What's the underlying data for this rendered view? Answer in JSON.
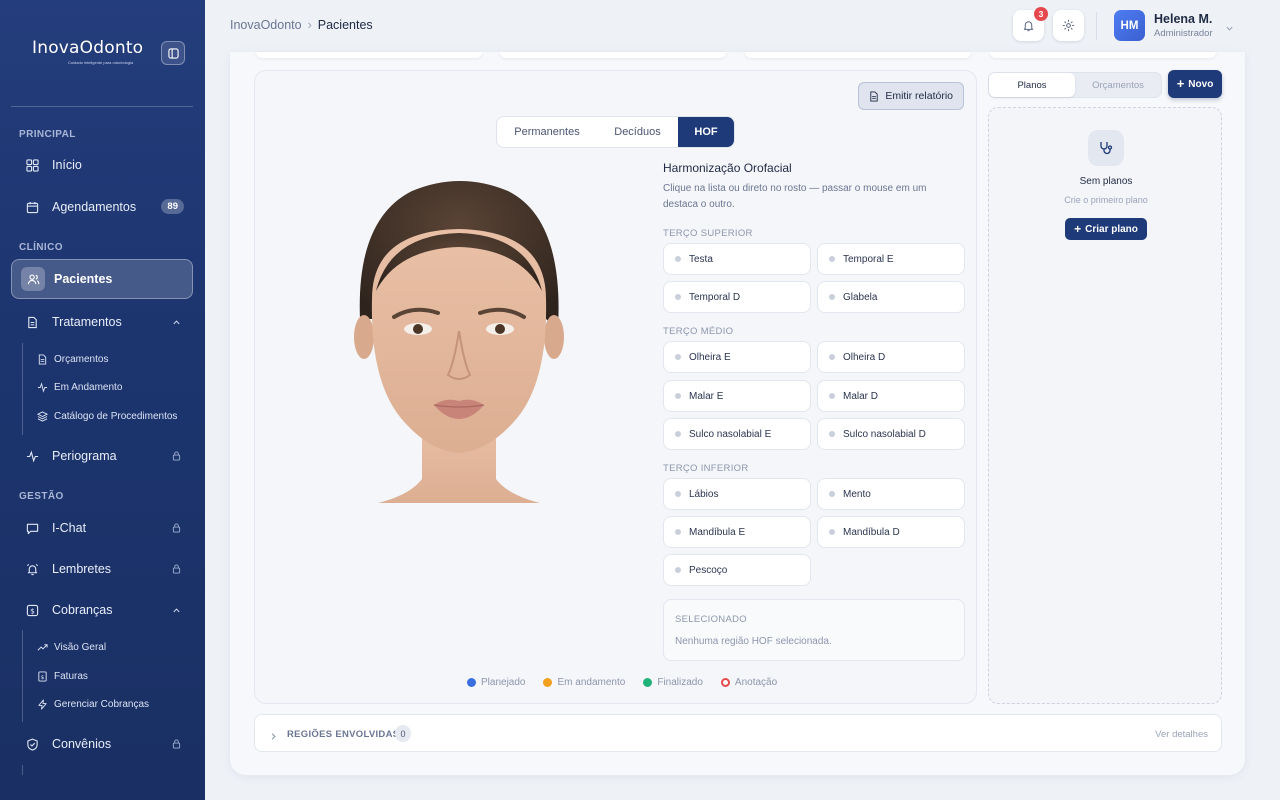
{
  "brand": {
    "name": "InovaOdonto",
    "tagline": "Cuidado inteligente para odontologia"
  },
  "sidebar": {
    "sections": {
      "principal": "PRINCIPAL",
      "clinico": "CLÍNICO",
      "gestao": "GESTÃO"
    },
    "items": {
      "inicio": "Início",
      "agendamentos": "Agendamentos",
      "agendamentos_badge": "89",
      "pacientes": "Pacientes",
      "tratamentos": "Tratamentos",
      "orcamentos": "Orçamentos",
      "em_andamento": "Em Andamento",
      "catalogo": "Catálogo de Procedimentos",
      "periograma": "Periograma",
      "ichat": "I-Chat",
      "lembretes": "Lembretes",
      "cobrancas": "Cobranças",
      "visao_geral": "Visão Geral",
      "faturas": "Faturas",
      "gerenciar": "Gerenciar Cobranças",
      "convenios": "Convênios"
    }
  },
  "topbar": {
    "breadcrumb_root": "InovaOdonto",
    "breadcrumb_sep": "›",
    "breadcrumb_current": "Pacientes",
    "notifications": "3",
    "user_initials": "HM",
    "user_name": "Helena M.",
    "user_role": "Administrador"
  },
  "hof": {
    "emit_label": "Emitir relatório",
    "tabs": [
      "Permanentes",
      "Decíduos",
      "HOF"
    ],
    "active_tab": "HOF",
    "title": "Harmonização Orofacial",
    "description": "Clique na lista ou direto no rosto — passar o mouse em um destaca o outro.",
    "groups": {
      "superior": {
        "label": "TERÇO SUPERIOR",
        "regions": [
          "Testa",
          "Temporal E",
          "Temporal D",
          "Glabela"
        ]
      },
      "medio": {
        "label": "TERÇO MÉDIO",
        "regions": [
          "Olheira E",
          "Olheira D",
          "Malar E",
          "Malar D",
          "Sulco nasolabial E",
          "Sulco nasolabial D"
        ]
      },
      "inferior": {
        "label": "TERÇO INFERIOR",
        "regions": [
          "Lábios",
          "Mento",
          "Mandíbula E",
          "Mandíbula D",
          "Pescoço"
        ]
      }
    },
    "selected_label": "SELECIONADO",
    "selected_empty": "Nenhuma região HOF selecionada.",
    "legend": [
      {
        "label": "Planejado",
        "color": "#3b6fe0"
      },
      {
        "label": "Em andamento",
        "color": "#f2a01d"
      },
      {
        "label": "Finalizado",
        "color": "#1fb37a"
      },
      {
        "label": "Anotação",
        "color": "#e5484d"
      }
    ]
  },
  "plans": {
    "segments": [
      "Planos",
      "Orçamentos"
    ],
    "active_segment": "Planos",
    "new_label": "Novo",
    "empty_title": "Sem planos",
    "empty_sub": "Crie o primeiro plano",
    "create_label": "Criar plano"
  },
  "regions_bar": {
    "label": "REGIÕES ENVOLVIDAS",
    "count": "0",
    "link": "Ver detalhes"
  },
  "colors": {
    "primary": "#1e3a78",
    "sidebar": "#213a77",
    "badge": "#e5484d"
  }
}
